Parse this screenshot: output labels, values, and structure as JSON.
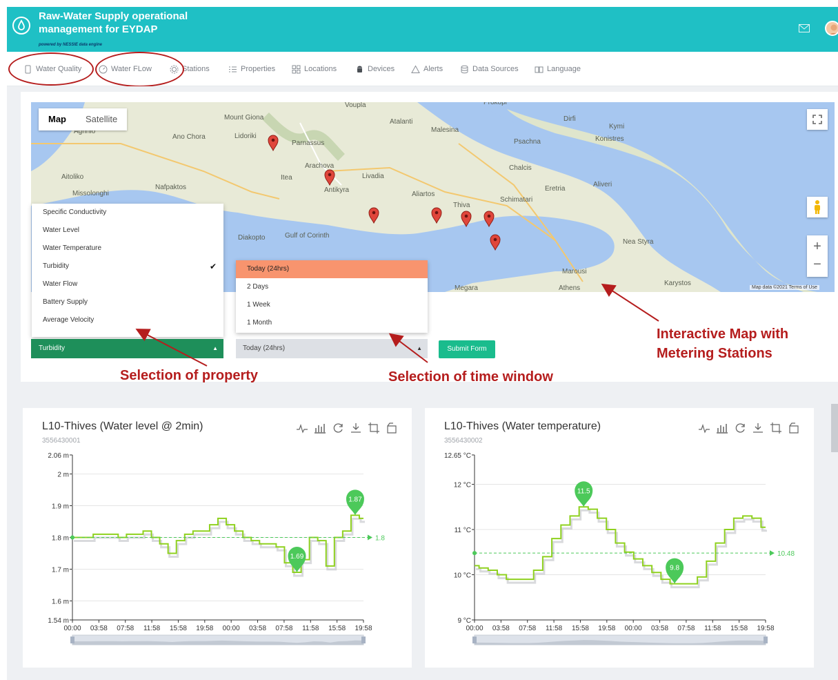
{
  "header": {
    "title_line1": "Raw-Water Supply operational",
    "title_line2": "management for EYDAP",
    "powered": "powered by NESSIE data engine"
  },
  "nav": {
    "items": [
      {
        "label": "Water Quality"
      },
      {
        "label": "Water FLow"
      },
      {
        "label": "Stations"
      },
      {
        "label": "Properties"
      },
      {
        "label": "Locations"
      },
      {
        "label": "Devices"
      },
      {
        "label": "Alerts"
      },
      {
        "label": "Data Sources"
      },
      {
        "label": "Language"
      }
    ]
  },
  "map": {
    "tab_map": "Map",
    "tab_satellite": "Satellite",
    "footer": "Map data ©2021   Terms of Use",
    "labels": [
      {
        "t": "Mount Giona"
      },
      {
        "t": "Parnassus"
      },
      {
        "t": "Arachova"
      },
      {
        "t": "Antikyra"
      },
      {
        "t": "Livadia"
      },
      {
        "t": "Chalcis"
      },
      {
        "t": "Thiva"
      },
      {
        "t": "Eretria"
      },
      {
        "t": "Nafpaktos"
      },
      {
        "t": "Itea"
      },
      {
        "t": "Lidoriki"
      },
      {
        "t": "Gulf of Corinth"
      },
      {
        "t": "Diakopto"
      },
      {
        "t": "Marousi"
      },
      {
        "t": "Athens"
      },
      {
        "t": "Megara"
      },
      {
        "t": "Dirfi"
      },
      {
        "t": "Kymi"
      },
      {
        "t": "Psachna"
      },
      {
        "t": "Nea Styra"
      },
      {
        "t": "Karystos"
      },
      {
        "t": "Malesina"
      },
      {
        "t": "Atalanti"
      },
      {
        "t": "Agrinio"
      },
      {
        "t": "Aitoliko"
      },
      {
        "t": "Missolonghi"
      },
      {
        "t": "Ano Chora"
      },
      {
        "t": "Aliartos"
      },
      {
        "t": "Schimatari"
      },
      {
        "t": "Aliveri"
      },
      {
        "t": "Konistres"
      },
      {
        "t": "Prokopi"
      },
      {
        "t": "Voupla"
      }
    ]
  },
  "property_menu": {
    "options": [
      "Specific Conductivity",
      "Water Level",
      "Water Temperature",
      "Turbidity",
      "Water Flow",
      "Battery Supply",
      "Average Velocity"
    ],
    "checked": "Turbidity",
    "selected": "Turbidity"
  },
  "time_menu": {
    "options": [
      "Today (24hrs)",
      "2 Days",
      "1 Week",
      "1 Month"
    ],
    "selected": "Today (24hrs)"
  },
  "submit_label": "Submit Form",
  "annotations": {
    "property": "Selection  of property",
    "time": "Selection of time window",
    "map_line1": "Interactive Map with",
    "map_line2": "Metering Stations"
  },
  "colors": {
    "header": "#1fc0c5",
    "series": "#8fd11f",
    "marker": "#4cc95a",
    "annotation": "#b51d1d"
  },
  "chart_data": [
    {
      "type": "line",
      "title": "L10-Thives  (Water level @ 2min)",
      "subtitle": "3556430001",
      "x": [
        "00:00",
        "03:58",
        "07:58",
        "11:58",
        "15:58",
        "19:58",
        "00:00",
        "03:58",
        "07:58",
        "11:58",
        "15:58",
        "19:58"
      ],
      "y_ticks": [
        "2.06 m",
        "2 m",
        "1.9 m",
        "1.8 m",
        "1.7 m",
        "1.6 m",
        "1.54 m"
      ],
      "ylim": [
        1.54,
        2.06
      ],
      "series": [
        {
          "values": [
            1.8,
            1.8,
            1.8,
            1.81,
            1.81,
            1.81,
            1.8,
            1.81,
            1.81,
            1.82,
            1.8,
            1.78,
            1.75,
            1.79,
            1.81,
            1.82,
            1.82,
            1.84,
            1.86,
            1.84,
            1.82,
            1.8,
            1.79,
            1.78,
            1.78,
            1.77,
            1.72,
            1.69,
            1.73,
            1.8,
            1.79,
            1.71,
            1.8,
            1.82,
            1.87,
            1.86
          ]
        }
      ],
      "average": 1.8,
      "max": 1.87,
      "min": 1.69
    },
    {
      "type": "line",
      "title": "L10-Thives  (Water temperature)",
      "subtitle": "3556430002",
      "x": [
        "00:00",
        "03:58",
        "07:58",
        "11:58",
        "15:58",
        "19:58",
        "00:00",
        "03:58",
        "07:58",
        "11:58",
        "15:58",
        "19:58"
      ],
      "y_ticks": [
        "12.65 °C",
        "12 °C",
        "11 °C",
        "10 °C",
        "9 °C"
      ],
      "ylim": [
        9,
        12.65
      ],
      "series": [
        {
          "values": [
            10.2,
            10.15,
            10.1,
            10.0,
            9.9,
            9.9,
            9.9,
            10.1,
            10.4,
            10.8,
            11.1,
            11.3,
            11.5,
            11.45,
            11.25,
            11.0,
            10.7,
            10.5,
            10.35,
            10.2,
            10.05,
            9.9,
            9.8,
            9.8,
            9.8,
            9.95,
            10.3,
            10.7,
            11.0,
            11.25,
            11.3,
            11.25,
            11.05
          ]
        }
      ],
      "average": 10.48,
      "max": 11.5,
      "min": 9.8
    }
  ]
}
